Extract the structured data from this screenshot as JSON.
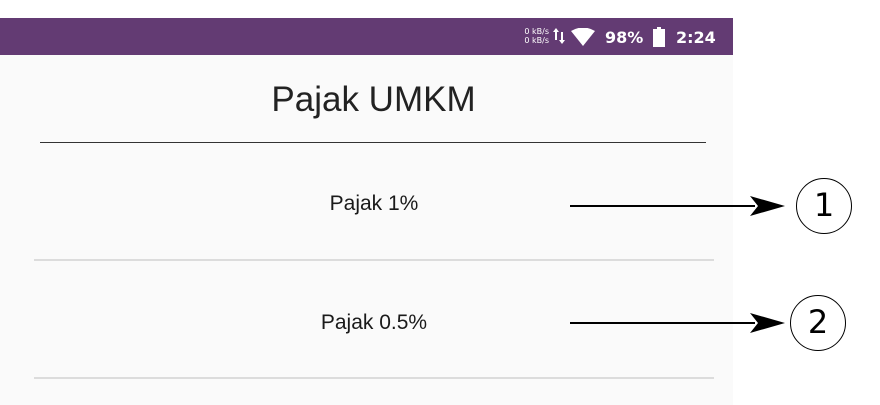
{
  "status_bar": {
    "net_speed_up": "0 kB/s",
    "net_speed_down": "0 kB/s",
    "data_icon": "data-arrows-icon",
    "wifi_icon": "wifi-icon",
    "battery_percent": "98%",
    "battery_icon": "battery-icon",
    "time": "2:24",
    "bg_color": "#633b73"
  },
  "title": "Pajak UMKM",
  "items": [
    {
      "label": "Pajak 1%"
    },
    {
      "label": "Pajak 0.5%"
    }
  ],
  "callouts": [
    {
      "number": "1"
    },
    {
      "number": "2"
    }
  ]
}
